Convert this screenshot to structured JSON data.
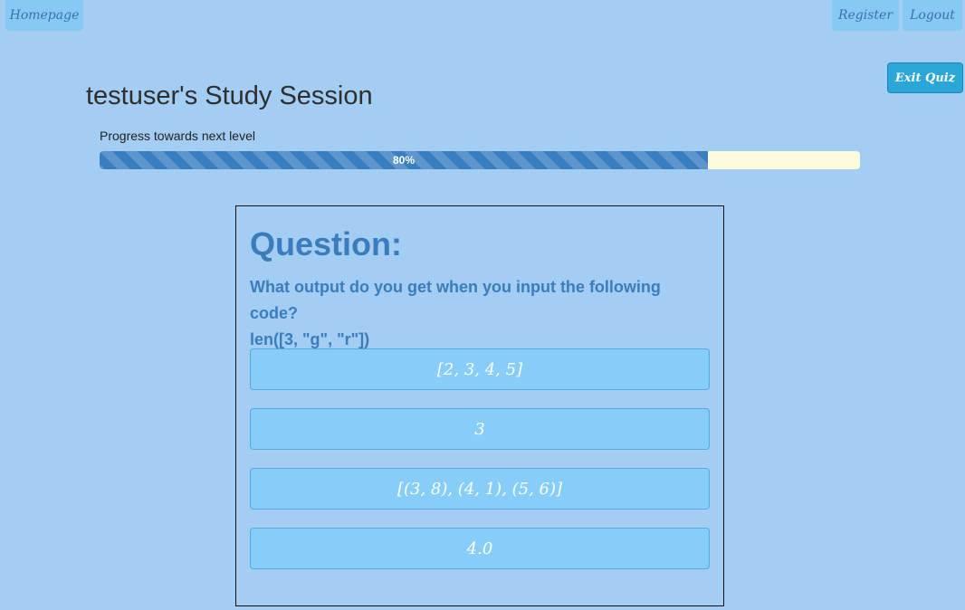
{
  "nav": {
    "home_label": "Homepage",
    "register_label": "Register",
    "logout_label": "Logout"
  },
  "exit_quiz_label": "Exit Quiz",
  "session_title": "testuser's Study Session",
  "progress": {
    "label": "Progress towards next level",
    "value_percent": 80,
    "value_text": "80%"
  },
  "question": {
    "heading": "Question:",
    "prompt": "What output do you get when you input the following code?",
    "code": "len([3, \"g\", \"r\"])",
    "answers": [
      "[2, 3, 4, 5]",
      "3",
      "[(3, 8), (4, 1), (5, 6)]",
      "4.0"
    ]
  },
  "colors": {
    "background": "#a3cdf2",
    "progress_fill": "#3a7ec2",
    "progress_track": "#fcfcdb",
    "answer_button": "#87cdf9",
    "exit_button": "#2aa6d8",
    "question_text": "#3a7dbd"
  }
}
